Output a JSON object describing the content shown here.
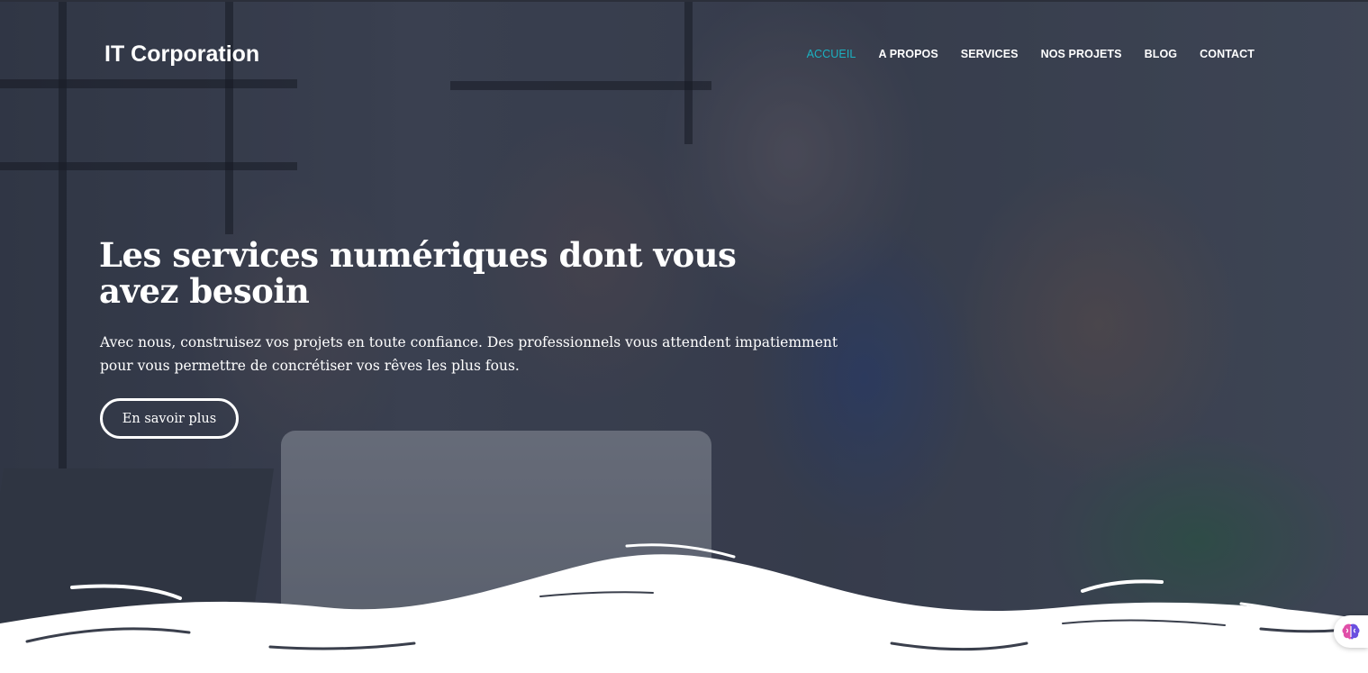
{
  "brand": {
    "name": "IT Corporation"
  },
  "nav": {
    "items": [
      {
        "label": "ACCUEIL",
        "active": true
      },
      {
        "label": "A PROPOS",
        "active": false
      },
      {
        "label": "SERVICES",
        "active": false
      },
      {
        "label": "NOS PROJETS",
        "active": false
      },
      {
        "label": "BLOG",
        "active": false
      },
      {
        "label": "CONTACT",
        "active": false
      }
    ]
  },
  "hero": {
    "headline": "Les services numériques dont vous avez besoin",
    "lead": "Avec nous, construisez vos projets en toute confiance. Des professionnels vous attendent impatiemment pour vous permettre de concrétiser vos rêves les plus fous.",
    "cta_label": "En savoir plus",
    "background": "team-at-laptop-photo"
  },
  "widget": {
    "icon": "brain-icon"
  },
  "colors": {
    "accent": "#1bb1c1",
    "text": "#ffffff",
    "overlay": "#2a2f3f"
  }
}
